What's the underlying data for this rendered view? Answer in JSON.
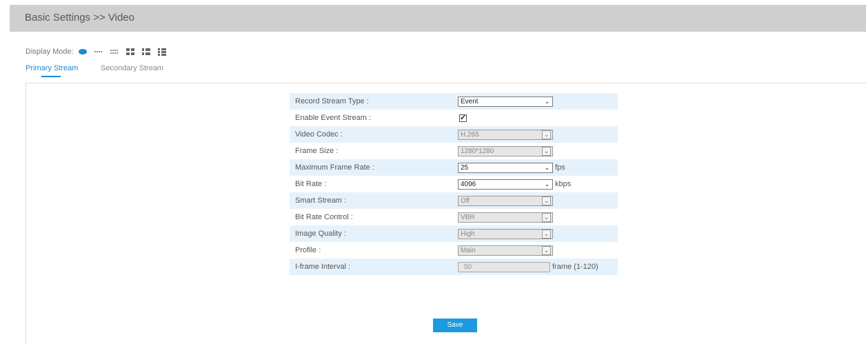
{
  "header": {
    "title": "Basic Settings >> Video"
  },
  "display_mode": {
    "label": "Display Mode:",
    "icons": [
      "oval-icon",
      "single-line-icon",
      "double-line-icon",
      "grid-2x2-icon",
      "grid-2x3-icon",
      "grid-3x3-icon"
    ]
  },
  "tabs": {
    "primary": "Primary Stream",
    "secondary": "Secondary Stream"
  },
  "form": {
    "record_stream_type": {
      "label": "Record Stream Type :",
      "value": "Event"
    },
    "enable_event_stream": {
      "label": "Enable Event Stream :",
      "checked": true
    },
    "video_codec": {
      "label": "Video Codec :",
      "value": "H.265"
    },
    "frame_size": {
      "label": "Frame Size :",
      "value": "1280*1280"
    },
    "max_frame_rate": {
      "label": "Maximum Frame Rate :",
      "value": "25",
      "unit": "fps"
    },
    "bit_rate": {
      "label": "Bit Rate :",
      "value": "4096",
      "unit": "kbps"
    },
    "smart_stream": {
      "label": "Smart Stream :",
      "value": "Off"
    },
    "bit_rate_control": {
      "label": "Bit Rate Control :",
      "value": "VBR"
    },
    "image_quality": {
      "label": "Image Quality :",
      "value": "High"
    },
    "profile": {
      "label": "Profile :",
      "value": "Main"
    },
    "iframe_interval": {
      "label": "I-frame Interval :",
      "value": "50",
      "unit": "frame (1-120)"
    }
  },
  "save_label": "Save",
  "colors": {
    "accent": "#1e9be0",
    "row_highlight": "#e6f2fb",
    "header_bg": "#cfcfcf"
  }
}
